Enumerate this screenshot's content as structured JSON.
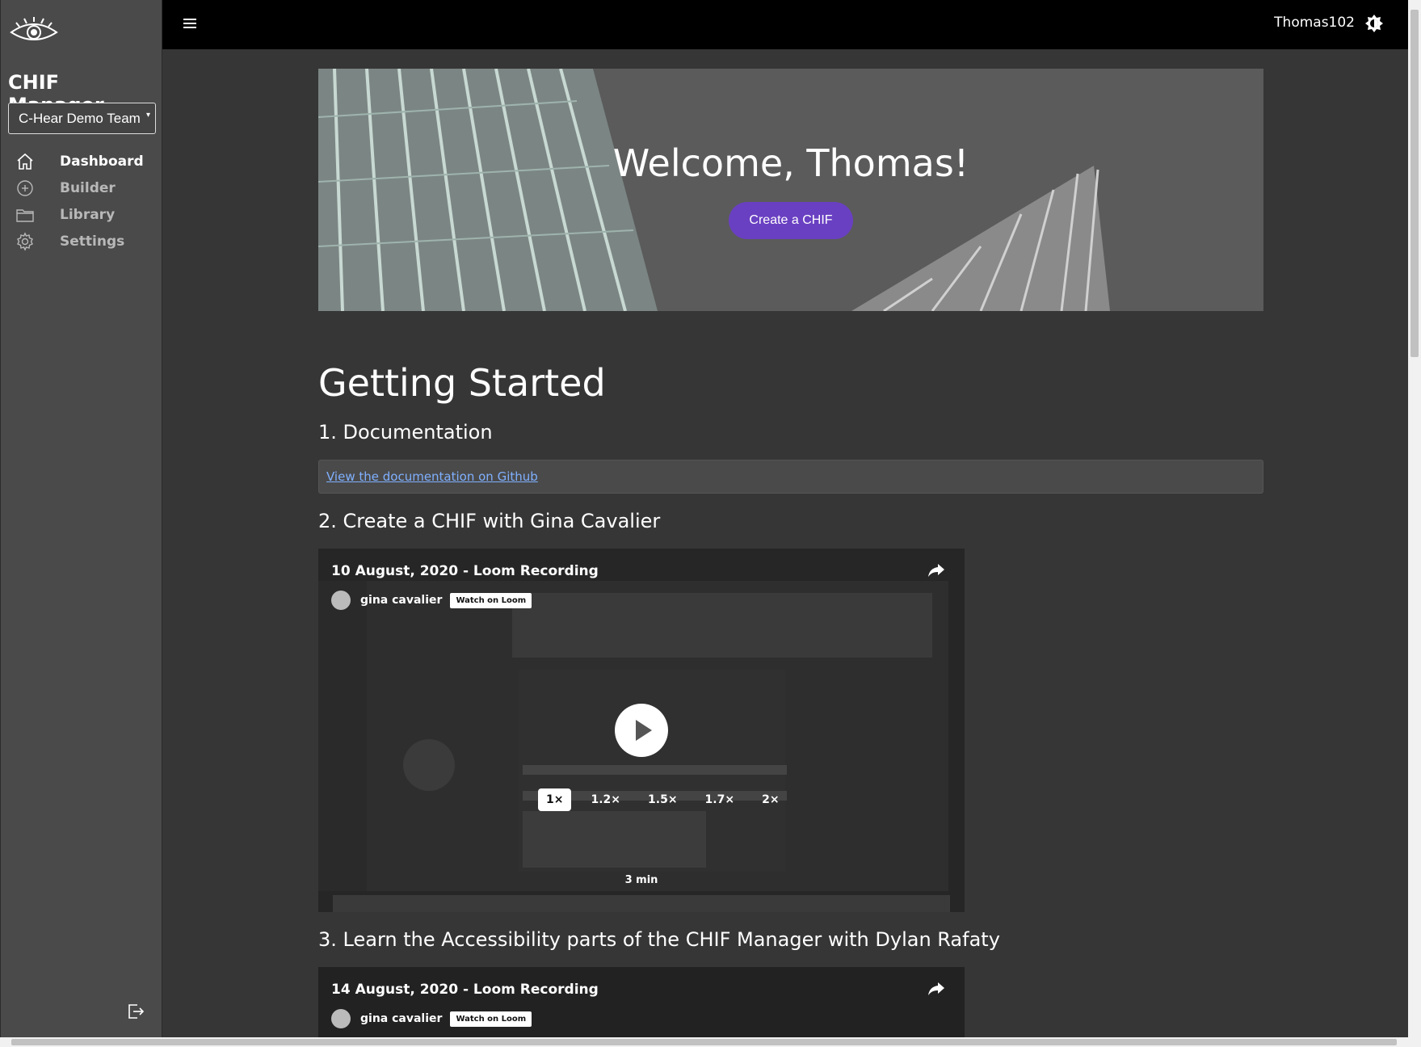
{
  "sidebar": {
    "app_title": "CHIF Manager",
    "team_select": "C-Hear Demo Team",
    "items": [
      {
        "label": "Dashboard",
        "icon": "home-icon",
        "active": true
      },
      {
        "label": "Builder",
        "icon": "plus-circle-icon",
        "active": false
      },
      {
        "label": "Library",
        "icon": "folder-icon",
        "active": false
      },
      {
        "label": "Settings",
        "icon": "gear-icon",
        "active": false
      }
    ]
  },
  "topbar": {
    "username": "Thomas102"
  },
  "hero": {
    "title": "Welcome, Thomas!",
    "button": "Create a CHIF"
  },
  "getting_started": {
    "title": "Getting Started",
    "doc_heading": "1. Documentation",
    "doc_link": "View the documentation on Github",
    "video1_heading": "2. Create a CHIF with Gina Cavalier",
    "video2_heading": "3. Learn the Accessibility parts of the CHIF Manager with Dylan Rafaty"
  },
  "videos": [
    {
      "title": "10 August, 2020 - Loom Recording",
      "author": "gina cavalier",
      "watch": "Watch on Loom",
      "speeds": [
        "1×",
        "1.2×",
        "1.5×",
        "1.7×",
        "2×"
      ],
      "duration": "3 min"
    },
    {
      "title": "14 August, 2020 - Loom Recording",
      "author": "gina cavalier",
      "watch": "Watch on Loom"
    }
  ],
  "colors": {
    "accent": "#6a40c2",
    "link": "#7fb0ff"
  }
}
